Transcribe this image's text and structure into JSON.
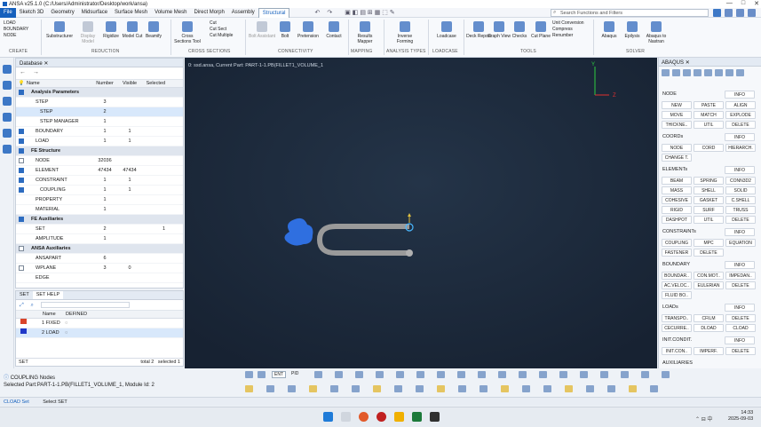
{
  "window": {
    "title": "ANSA v25.1.0 (C:/Users/Administrator/Desktop/work/ansa)",
    "controls": [
      "—",
      "□",
      "✕"
    ]
  },
  "menu_tabs": [
    "File",
    "Sketch 3D",
    "Geometry",
    "Midsurface",
    "Surface Mesh",
    "Volume Mesh",
    "Direct Morph",
    "Assembly",
    "Structural"
  ],
  "search": {
    "placeholder": "Search Functions and Filters"
  },
  "ribbon": {
    "create_items": [
      "LOAD",
      "BOUNDARY",
      "NODE"
    ],
    "buttons": [
      {
        "label": "Substructurer",
        "dim": false
      },
      {
        "label": "Display Model",
        "dim": true
      },
      {
        "label": "Rigidize",
        "dim": false
      },
      {
        "label": "Model Cut",
        "dim": false
      },
      {
        "label": "Beamify",
        "dim": false
      },
      {
        "label": "Cross Sections Tool",
        "dim": false
      },
      {
        "label": "Bolt Assistant",
        "dim": true
      },
      {
        "label": "Bolt",
        "dim": false
      },
      {
        "label": "Pretension",
        "dim": false
      },
      {
        "label": "Contact",
        "dim": false
      },
      {
        "label": "Results Mapper",
        "dim": false
      },
      {
        "label": "Inverse Forming",
        "dim": false
      },
      {
        "label": "Loadcase",
        "dim": false
      },
      {
        "label": "Deck Report",
        "dim": false
      },
      {
        "label": "Graph View",
        "dim": false
      },
      {
        "label": "Checks",
        "dim": false
      },
      {
        "label": "Cut Plane",
        "dim": false
      },
      {
        "label": "Abaqus",
        "dim": false
      },
      {
        "label": "Epilysis",
        "dim": false
      },
      {
        "label": "Abaqus to Nastran",
        "dim": false
      }
    ],
    "cut_items": [
      "Cut",
      "Cut Sect",
      "Cut Multiple"
    ],
    "tool_items": [
      "Unit Conversion",
      "Compress",
      "Renumber"
    ],
    "groups": [
      "CREATE",
      "REDUCTION",
      "CROSS SECTIONS",
      "CONNECTIVITY",
      "MAPPING",
      "ANALYSIS TYPES",
      "LOADCASE",
      "TOOLS",
      "SOLVER"
    ]
  },
  "database": {
    "tab": "Database",
    "columns": [
      "Name",
      "Number",
      "Visible",
      "Selected"
    ],
    "rows": [
      {
        "name": "Analysis Parameters",
        "num": "",
        "vis": "",
        "sel": "",
        "group": true,
        "chk": "on",
        "indent": 1
      },
      {
        "name": "STEP",
        "num": "3",
        "vis": "",
        "sel": "",
        "indent": 2
      },
      {
        "name": "STEP",
        "num": "2",
        "vis": "",
        "sel": "",
        "indent": 3,
        "selected": true
      },
      {
        "name": "STEP MANAGER",
        "num": "1",
        "vis": "",
        "sel": "",
        "indent": 3
      },
      {
        "name": "BOUNDARY",
        "num": "1",
        "vis": "1",
        "sel": "",
        "indent": 2,
        "chk": "on"
      },
      {
        "name": "LOAD",
        "num": "1",
        "vis": "1",
        "sel": "",
        "indent": 2,
        "chk": "on"
      },
      {
        "name": "FE Structure",
        "num": "",
        "vis": "",
        "sel": "",
        "group": true,
        "chk": "on",
        "indent": 1
      },
      {
        "name": "NODE",
        "num": "32036",
        "vis": "",
        "sel": "",
        "indent": 2,
        "chk": "off"
      },
      {
        "name": "ELEMENT",
        "num": "47434",
        "vis": "47434",
        "sel": "",
        "indent": 2,
        "chk": "on"
      },
      {
        "name": "CONSTRAINT",
        "num": "1",
        "vis": "1",
        "sel": "",
        "indent": 2,
        "chk": "on"
      },
      {
        "name": "COUPLING",
        "num": "1",
        "vis": "1",
        "sel": "",
        "indent": 3,
        "chk": "on"
      },
      {
        "name": "PROPERTY",
        "num": "1",
        "vis": "",
        "sel": "",
        "indent": 2
      },
      {
        "name": "MATERIAL",
        "num": "1",
        "vis": "",
        "sel": "",
        "indent": 2
      },
      {
        "name": "FE Auxiliaries",
        "num": "",
        "vis": "",
        "sel": "",
        "group": true,
        "chk": "on",
        "indent": 1
      },
      {
        "name": "SET",
        "num": "2",
        "vis": "",
        "sel": "1",
        "indent": 2
      },
      {
        "name": "AMPLITUDE",
        "num": "1",
        "vis": "",
        "sel": "",
        "indent": 2
      },
      {
        "name": "ANSA Auxiliaries",
        "num": "",
        "vis": "",
        "sel": "",
        "group": true,
        "chk": "off",
        "indent": 1
      },
      {
        "name": "ANSAPART",
        "num": "6",
        "vis": "",
        "sel": "",
        "indent": 2
      },
      {
        "name": "WPLANE",
        "num": "3",
        "vis": "0",
        "sel": "",
        "indent": 2,
        "chk": "off"
      },
      {
        "name": "EDGE",
        "num": "",
        "vis": "",
        "sel": "",
        "indent": 2
      }
    ]
  },
  "setpanel": {
    "tabs": [
      "SET",
      "SET HELP"
    ],
    "columns": [
      "Name",
      "DEFINED"
    ],
    "rows": [
      {
        "name": "1 FIXED",
        "color": "#d9442b"
      },
      {
        "name": "2 LOAD",
        "color": "#2038c8",
        "selected": true
      }
    ],
    "footer_left": "SET",
    "footer_total": "total 2",
    "footer_selected": "selected 1"
  },
  "viewport": {
    "info": "0: ssd.ansa, Current Part: PART-1-1.PB(FILLET1_VOLUME_1",
    "bg": "#1c2a3c"
  },
  "abaqus": {
    "tab": "ABAQUS",
    "sections": [
      {
        "title": "NODE",
        "info": "INFO",
        "buttons": [
          "NEW",
          "PASTE",
          "ALIGN",
          "MOVE",
          "MATCH",
          "EXPLODE",
          "THICKNE..",
          "UTIL",
          "DELETE"
        ]
      },
      {
        "title": "COORDs",
        "info": "INFO",
        "buttons": [
          "NODE",
          "CORD",
          "HIERARCH.",
          "CHANGE T."
        ]
      },
      {
        "title": "ELEMENTs",
        "info": "INFO",
        "buttons": [
          "BEAM",
          "SPRING",
          "CONN3D2",
          "MASS",
          "SHELL",
          "SOLID",
          "COHESIVE",
          "GASKET",
          "C.SHELL",
          "RIGID",
          "SURF",
          "TRUSS",
          "DASHPOT",
          "UTIL",
          "DELETE"
        ]
      },
      {
        "title": "CONSTRAINTs",
        "info": "INFO",
        "buttons": [
          "COUPLING",
          "MPC",
          "EQUATION",
          "FASTENER",
          "DELETE"
        ]
      },
      {
        "title": "BOUNDARY",
        "info": "INFO",
        "buttons": [
          "BOUNDAR..",
          "CON.MOT..",
          "IMPEDAN..",
          "AC.VELOC..",
          "EULERIAN",
          "DELETE",
          "FLUID BO.."
        ]
      },
      {
        "title": "LOADs",
        "info": "INFO",
        "buttons": [
          "TRANSPO..",
          "CFILM",
          "DELETE",
          "CECURRE..",
          "DLOAD",
          "CLOAD"
        ]
      },
      {
        "title": "INIT.CONDIT.",
        "info": "INFO",
        "buttons": [
          "INIT.CON..",
          "IMPERF.",
          "DELETE"
        ]
      },
      {
        "title": "AUXILIARIES",
        "info": "",
        "buttons": []
      }
    ]
  },
  "bottom_toolbar": {
    "entity": "ENT",
    "pid": "PID"
  },
  "status": {
    "line1": "COUPLING Nodes",
    "line2": "Selected Part:PART-1-1.PB(FILLET1_VOLUME_1, Module Id: 2",
    "command": "CLOAD Set",
    "prompt": "Select SET"
  },
  "taskbar": {
    "time": "14:33",
    "date": "2025-09-03"
  },
  "colors": {
    "accent": "#1560bd",
    "viewport": "#1c2a3c",
    "model": "#9a9a9a",
    "coupling": "#2f6fe0"
  }
}
